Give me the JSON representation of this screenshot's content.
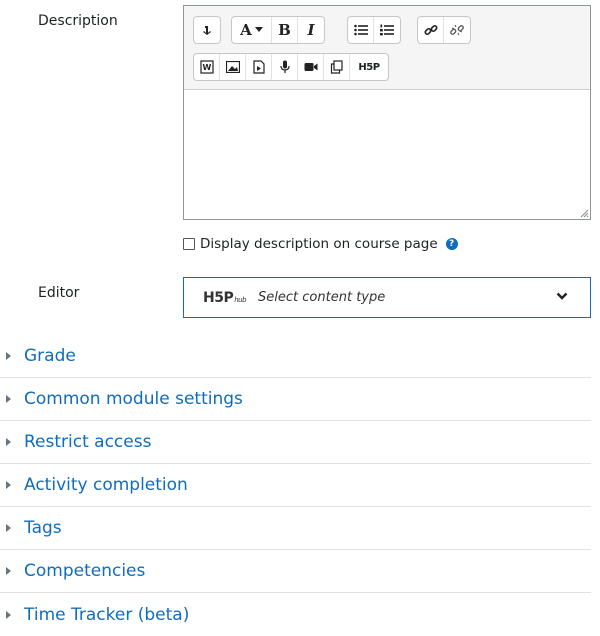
{
  "description_label": "Description",
  "editor_label": "Editor",
  "toolbar": {
    "text_bold": "B",
    "text_italic": "I",
    "font_color": "A",
    "h5p_button": "H5P"
  },
  "display_description": {
    "label": "Display description on course page",
    "checked": false,
    "help_icon": "question-circle-icon"
  },
  "h5p_editor": {
    "logo_text": "H5P",
    "logo_sub": "hub",
    "placeholder": "Select content type"
  },
  "sections": [
    {
      "label": "Grade"
    },
    {
      "label": "Common module settings"
    },
    {
      "label": "Restrict access"
    },
    {
      "label": "Activity completion"
    },
    {
      "label": "Tags"
    },
    {
      "label": "Competencies"
    },
    {
      "label": "Time Tracker (beta)"
    }
  ],
  "colors": {
    "link": "#0f6cbf",
    "border": "#8f959e",
    "help": "#0f6cbf"
  }
}
